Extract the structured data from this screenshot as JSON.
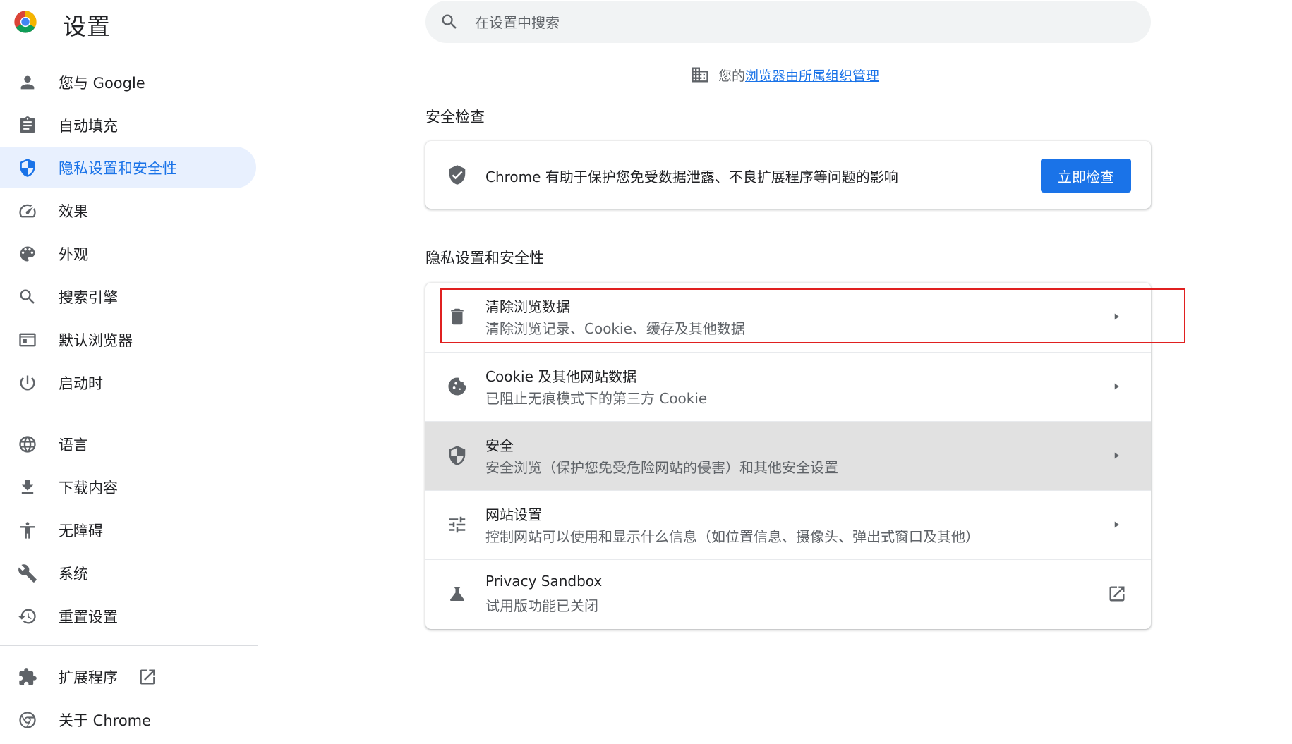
{
  "app": {
    "title": "设置",
    "logo_icon": "chrome-logo-icon"
  },
  "search": {
    "placeholder": "在设置中搜索",
    "value": ""
  },
  "managed_notice": {
    "prefix": "您的",
    "link": "浏览器由所属组织管理",
    "icon": "business-icon"
  },
  "sidebar": {
    "active_item": "隐私设置和安全性",
    "groups": [
      {
        "items": [
          {
            "label": "您与 Google",
            "icon": "person-icon"
          },
          {
            "label": "自动填充",
            "icon": "assignment-icon"
          },
          {
            "label": "隐私设置和安全性",
            "icon": "shield-icon"
          },
          {
            "label": "效果",
            "icon": "speed-icon"
          },
          {
            "label": "外观",
            "icon": "palette-icon"
          },
          {
            "label": "搜索引擎",
            "icon": "search-icon"
          },
          {
            "label": "默认浏览器",
            "icon": "browser-icon"
          },
          {
            "label": "启动时",
            "icon": "power-icon"
          }
        ]
      },
      {
        "items": [
          {
            "label": "语言",
            "icon": "globe-icon"
          },
          {
            "label": "下载内容",
            "icon": "download-icon"
          },
          {
            "label": "无障碍",
            "icon": "accessibility-icon"
          },
          {
            "label": "系统",
            "icon": "wrench-icon"
          },
          {
            "label": "重置设置",
            "icon": "restore-icon"
          }
        ]
      },
      {
        "items": [
          {
            "label": "扩展程序",
            "icon": "extension-icon",
            "trailing_icon": "open-in-new-icon"
          },
          {
            "label": "关于 Chrome",
            "icon": "chrome-icon"
          }
        ]
      }
    ]
  },
  "safety_check": {
    "title": "安全检查",
    "description": "Chrome 有助于保护您免受数据泄露、不良扩展程序等问题的影响",
    "button": "立即检查",
    "icon": "verified-shield-icon"
  },
  "privacy": {
    "title": "隐私设置和安全性",
    "rows": [
      {
        "title": "清除浏览数据",
        "subtitle": "清除浏览记录、Cookie、缓存及其他数据",
        "icon": "trash-icon",
        "trailing": "arrow-right-icon",
        "highlighted": true
      },
      {
        "title": "Cookie 及其他网站数据",
        "subtitle": "已阻止无痕模式下的第三方 Cookie",
        "icon": "cookie-icon",
        "trailing": "arrow-right-icon"
      },
      {
        "title": "安全",
        "subtitle": "安全浏览（保护您免受危险网站的侵害）和其他安全设置",
        "icon": "security-shield-icon",
        "trailing": "arrow-right-icon",
        "hovered": true
      },
      {
        "title": "网站设置",
        "subtitle": "控制网站可以使用和显示什么信息（如位置信息、摄像头、弹出式窗口及其他）",
        "icon": "tune-icon",
        "trailing": "arrow-right-icon"
      },
      {
        "title": "Privacy Sandbox",
        "subtitle": "试用版功能已关闭",
        "icon": "flask-icon",
        "trailing": "open-in-new-icon"
      }
    ]
  },
  "colors": {
    "accent": "#1a73e8",
    "active_bg": "#e8f0fe",
    "highlight_border": "#e02020",
    "hover_row": "#e1e1e1"
  }
}
